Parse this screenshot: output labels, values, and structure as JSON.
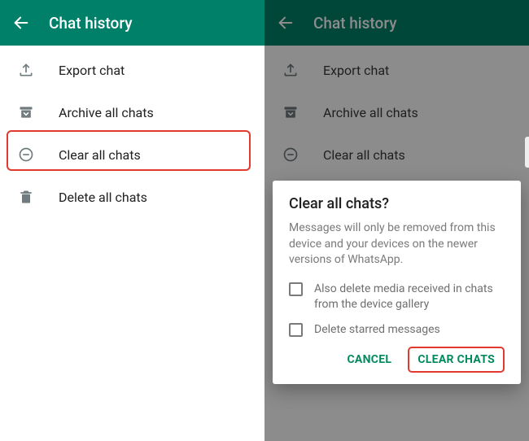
{
  "left": {
    "header": {
      "title": "Chat history"
    },
    "menu": {
      "export": {
        "label": "Export chat"
      },
      "archive": {
        "label": "Archive all chats"
      },
      "clear": {
        "label": "Clear all chats"
      },
      "delete": {
        "label": "Delete all chats"
      }
    }
  },
  "right": {
    "header": {
      "title": "Chat history"
    },
    "menu": {
      "export": {
        "label": "Export chat"
      },
      "archive": {
        "label": "Archive all chats"
      },
      "clear": {
        "label": "Clear all chats"
      }
    },
    "dialog": {
      "title": "Clear all chats?",
      "body": "Messages will only be removed from this device and your devices on the newer versions of WhatsApp.",
      "check_media": "Also delete media received in chats from the device gallery",
      "check_starred": "Delete starred messages",
      "cancel": "CANCEL",
      "confirm": "CLEAR CHATS"
    }
  },
  "colors": {
    "brand": "#008069",
    "accent": "#008a5e",
    "highlight": "#e23a2e"
  }
}
